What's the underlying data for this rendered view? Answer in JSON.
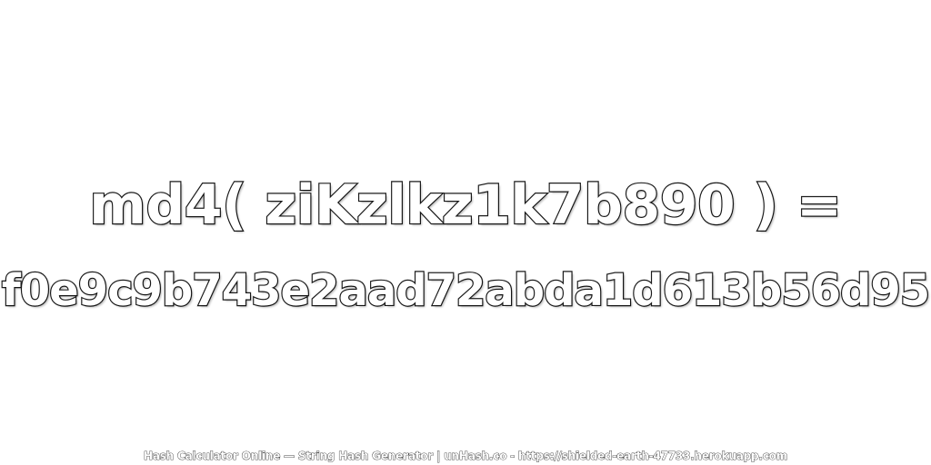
{
  "expression": "md4( ziKzlkz1k7b890 ) =",
  "hash": "f0e9c9b743e2aad72abda1d613b56d95",
  "footer": "Hash Calculator Online — String Hash Generator | unHash.co - https://shielded-earth-47733.herokuapp.com"
}
